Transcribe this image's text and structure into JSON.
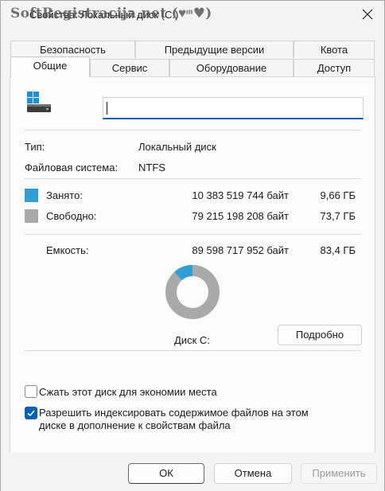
{
  "window": {
    "title": "Свойства: Локальный диск (C:)",
    "watermark": "SoftRegistracija.net (♥ͫ♥)"
  },
  "tabs_row1": [
    "Безопасность",
    "Предыдущие версии",
    "Квота"
  ],
  "tabs_row2": [
    "Общие",
    "Сервис",
    "Оборудование",
    "Доступ"
  ],
  "active_tab": "Общие",
  "general": {
    "drive_name_value": "",
    "type_label": "Тип:",
    "type_value": "Локальный диск",
    "fs_label": "Файловая система:",
    "fs_value": "NTFS",
    "used_label": "Занято:",
    "used_bytes": "10 383 519 744 байт",
    "used_gb": "9,66 ГБ",
    "free_label": "Свободно:",
    "free_bytes": "79 215 198 208 байт",
    "free_gb": "73,7 ГБ",
    "capacity_label": "Емкость:",
    "capacity_bytes": "89 598 717 952 байт",
    "capacity_gb": "83,4 ГБ",
    "disk_label": "Диск C:",
    "details_button": "Подробно",
    "used_fraction": 0.1159,
    "compress_label": "Сжать этот диск для экономии места",
    "compress_checked": false,
    "index_label_line1": "Разрешить индексировать содержимое файлов на этом",
    "index_label_line2": "диске в дополнение к свойствам файла",
    "index_checked": true
  },
  "colors": {
    "used": "#2f9fd6",
    "free": "#a9a9a9",
    "accent": "#005fb8"
  },
  "footer": {
    "ok": "ОК",
    "cancel": "Отмена",
    "apply": "Применить"
  }
}
